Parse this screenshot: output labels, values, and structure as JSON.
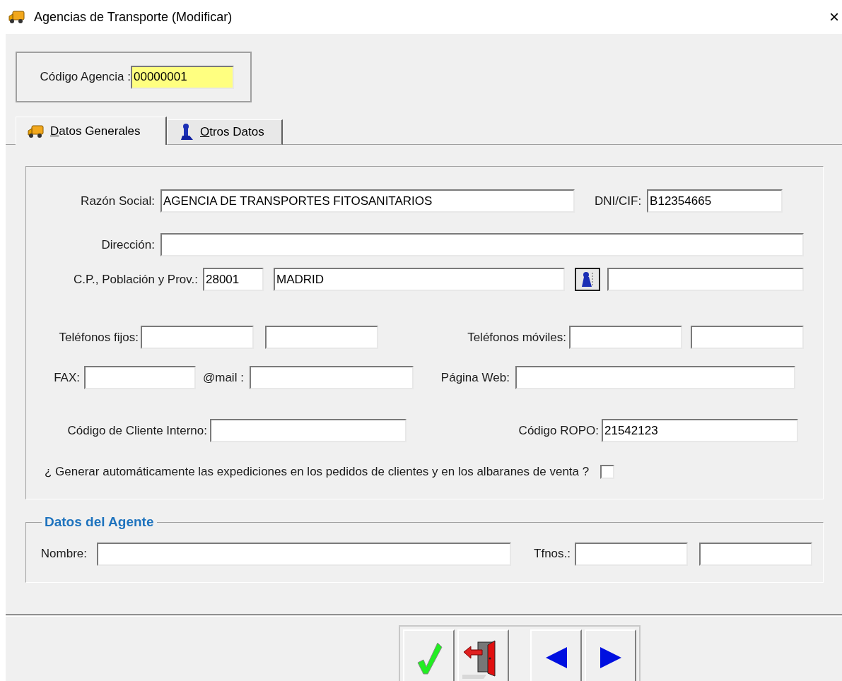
{
  "window": {
    "title": "Agencias de Transporte (Modificar)",
    "close": "×"
  },
  "codigo": {
    "label": "Código Agencia :",
    "value": "00000001"
  },
  "tabs": [
    {
      "label": "Datos Generales",
      "selected": true,
      "kind": "truck"
    },
    {
      "label": "Otros Datos",
      "selected": false,
      "kind": "pawn"
    }
  ],
  "general": {
    "razon_social": {
      "label": "Razón Social:",
      "value": "AGENCIA DE TRANSPORTES FITOSANITARIOS"
    },
    "dni_cif": {
      "label": "DNI/CIF:",
      "value": "B12354665"
    },
    "direccion": {
      "label": "Dirección:"
    },
    "cp_poblacion_prov": {
      "label": "C.P., Población y Prov.:",
      "cp": "28001",
      "poblacion": "MADRID"
    },
    "telefonos_fijos": {
      "label": "Teléfonos fijos:"
    },
    "telefonos_moviles": {
      "label": "Teléfonos móviles:"
    },
    "fax": {
      "label": "FAX:"
    },
    "mail": {
      "label": "@mail :"
    },
    "pagina_web": {
      "label": "Página Web:"
    },
    "codigo_cliente_interno": {
      "label": "Código de Cliente Interno:"
    },
    "codigo_ropo": {
      "label": "Código ROPO:",
      "value": "21542123"
    },
    "generar_expediciones": {
      "label": "¿ Generar automáticamente las expediciones en los pedidos de clientes y en los albaranes de venta ?",
      "checked": false
    }
  },
  "agente": {
    "title": "Datos del Agente",
    "nombre": {
      "label": "Nombre:"
    },
    "tfnos": {
      "label": "Tfnos.:"
    }
  },
  "buttons": [
    {
      "kind": "accept"
    },
    {
      "kind": "exit"
    },
    {
      "kind": "previous"
    },
    {
      "kind": "next"
    }
  ]
}
